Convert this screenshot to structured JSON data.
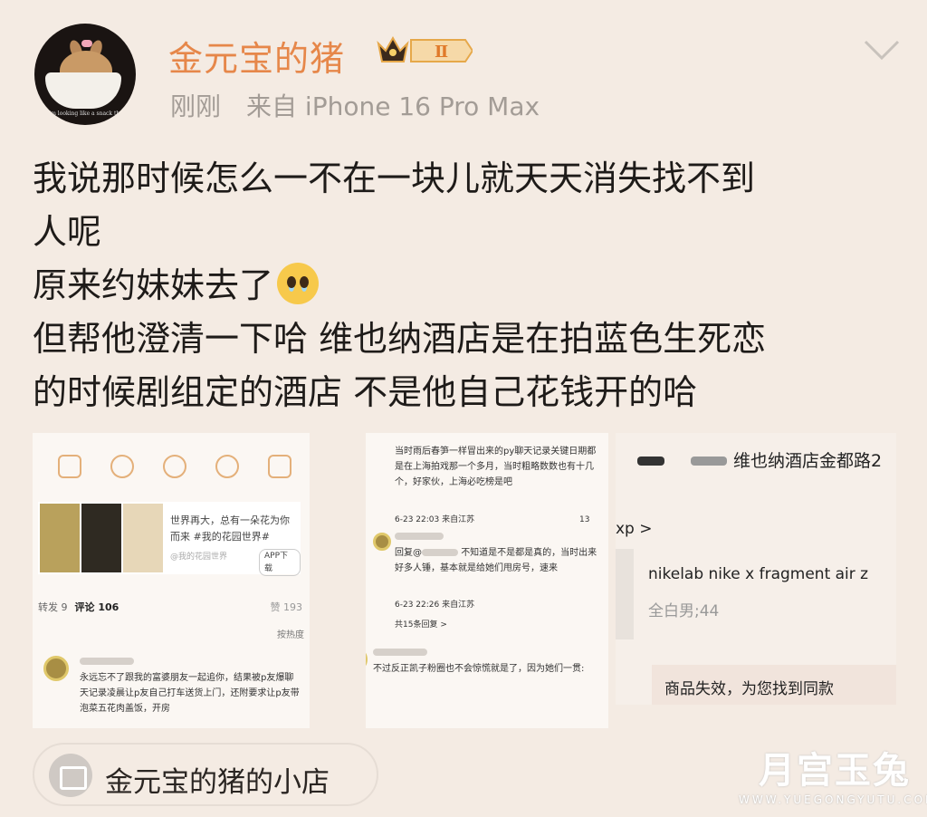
{
  "header": {
    "username": "金元宝的猪",
    "badge_level": "Ⅱ",
    "time": "刚刚",
    "source": "来自 iPhone 16 Pro Max",
    "avatar_caption": "I'm looking like a snack tho",
    "accent_color": "#e6874a",
    "icons": [
      "crown-badge-icon",
      "chevron-down-icon"
    ]
  },
  "post": {
    "lines": [
      "我说那时候怎么一不在一块儿就天天消失找不到",
      "人呢",
      "原来约妹妹去了",
      "但帮他澄清一下哈 维也纳酒店是在拍蓝色生死恋",
      "的时候剧组定的酒店 不是他自己花钱开的哈"
    ],
    "emoji": "pleading-face"
  },
  "screenshot1": {
    "ad_text": "世界再大，总有一朵花为你而来 #我的花园世界#",
    "ad_source": "@我的花园世界",
    "ad_button": "APP下载",
    "repost": "转发 9",
    "comments": "评论 106",
    "likes": "赞 193",
    "sort": "按热度",
    "comment_text": "永远忘不了跟我的富婆朋友一起追你，结果被p友爆聊天记录凌晨让p友自己打车送货上门，还附要求让p友带泡菜五花肉盖饭，开房"
  },
  "screenshot2": {
    "comment1": "当时雨后春笋一样冒出来的py聊天记录关键日期都是在上海拍戏那一个多月，当时粗略数数也有十几个，好家伙，上海必吃榜是吧",
    "comment1_time": "6-23 22:03 来自江苏",
    "comment1_likes": "13",
    "reply_prefix": "回复@",
    "reply_text": "不知道是不是都是真的，当时出来好多人锤，基本就是给她们甩房号，速来",
    "reply_time": "6-23 22:26 来自江苏",
    "more_replies": "共15条回复 >",
    "comment2": "不过反正凯子粉圈也不会惊慌就是了，因为她们一贯:"
  },
  "screenshot3": {
    "hotel_line": "维也纳酒店金都路2",
    "shop_stub": "xp >",
    "product_name": "nikelab nike x fragment air z",
    "product_detail": "全白男;44",
    "notice": "商品失效，为您找到同款"
  },
  "shop": {
    "label": "金元宝的猪的小店"
  },
  "watermark": {
    "logo": "月宫玉兔",
    "url": "WWW.YUEGONGYUTU.COM"
  }
}
